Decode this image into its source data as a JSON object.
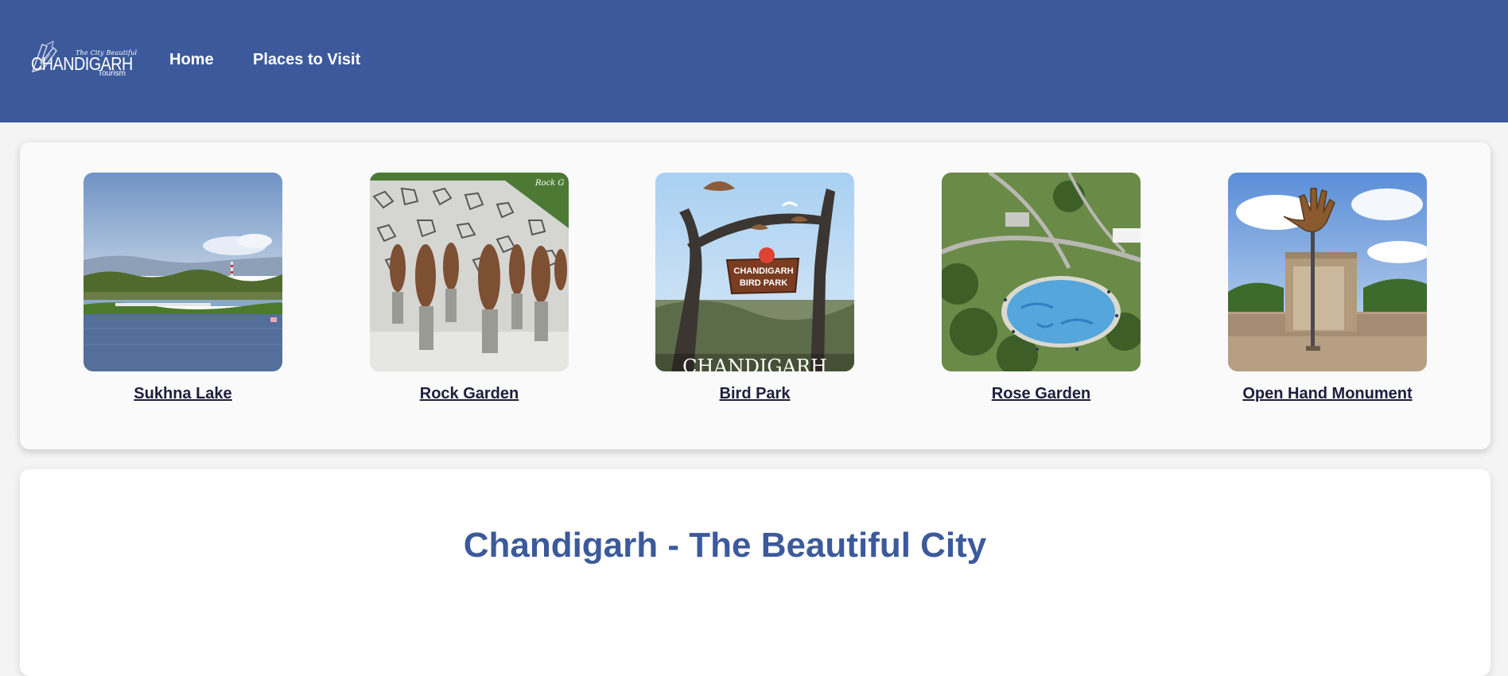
{
  "header": {
    "logo": {
      "tagline": "The City Beautiful",
      "name": "CHANDIGARH",
      "sub": "Tourism"
    },
    "nav": [
      {
        "label": "Home"
      },
      {
        "label": "Places to Visit"
      }
    ],
    "background_color": "#3c5a9b"
  },
  "places": [
    {
      "label": "Sukhna Lake",
      "image": "lake-photo"
    },
    {
      "label": "Rock Garden",
      "image": "rock-garden-statues-photo",
      "watermark": "Rock G"
    },
    {
      "label": "Bird Park",
      "image": "bird-park-gate-photo",
      "sign_line1": "CHANDIGARH",
      "sign_line2": "BIRD PARK",
      "overlay": "CHANDIGARH"
    },
    {
      "label": "Rose Garden",
      "image": "rose-garden-aerial-photo"
    },
    {
      "label": "Open Hand Monument",
      "image": "open-hand-monument-photo"
    }
  ],
  "intro": {
    "title": "Chandigarh - The Beautiful City",
    "title_color": "#3c5a9b"
  }
}
